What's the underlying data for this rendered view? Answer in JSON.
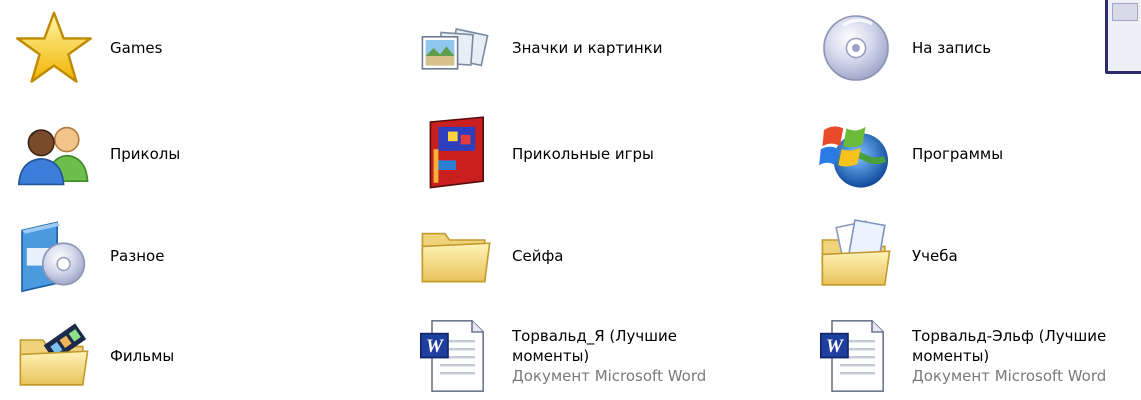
{
  "items": [
    {
      "label": "Games",
      "icon": "star-icon"
    },
    {
      "label": "Значки и картинки",
      "icon": "photos-icon"
    },
    {
      "label": "На запись",
      "icon": "cd-icon"
    },
    {
      "label": "Приколы",
      "icon": "users-icon"
    },
    {
      "label": "Прикольные игры",
      "icon": "game-box-icon"
    },
    {
      "label": "Программы",
      "icon": "windows-globe-icon"
    },
    {
      "label": "Разное",
      "icon": "software-cd-icon"
    },
    {
      "label": "Сейфа",
      "icon": "folder-icon"
    },
    {
      "label": "Учеба",
      "icon": "documents-folder-icon"
    },
    {
      "label": "Фильмы",
      "icon": "film-folder-icon"
    },
    {
      "label": "Торвальд_Я (Лучшие",
      "label2": "моменты)",
      "sub": "Документ Microsoft Word",
      "icon": "word-document-icon"
    },
    {
      "label": "Торвальд-Эльф (Лучшие",
      "label2": "моменты)",
      "sub": "Документ Microsoft Word",
      "icon": "word-document-icon"
    }
  ]
}
